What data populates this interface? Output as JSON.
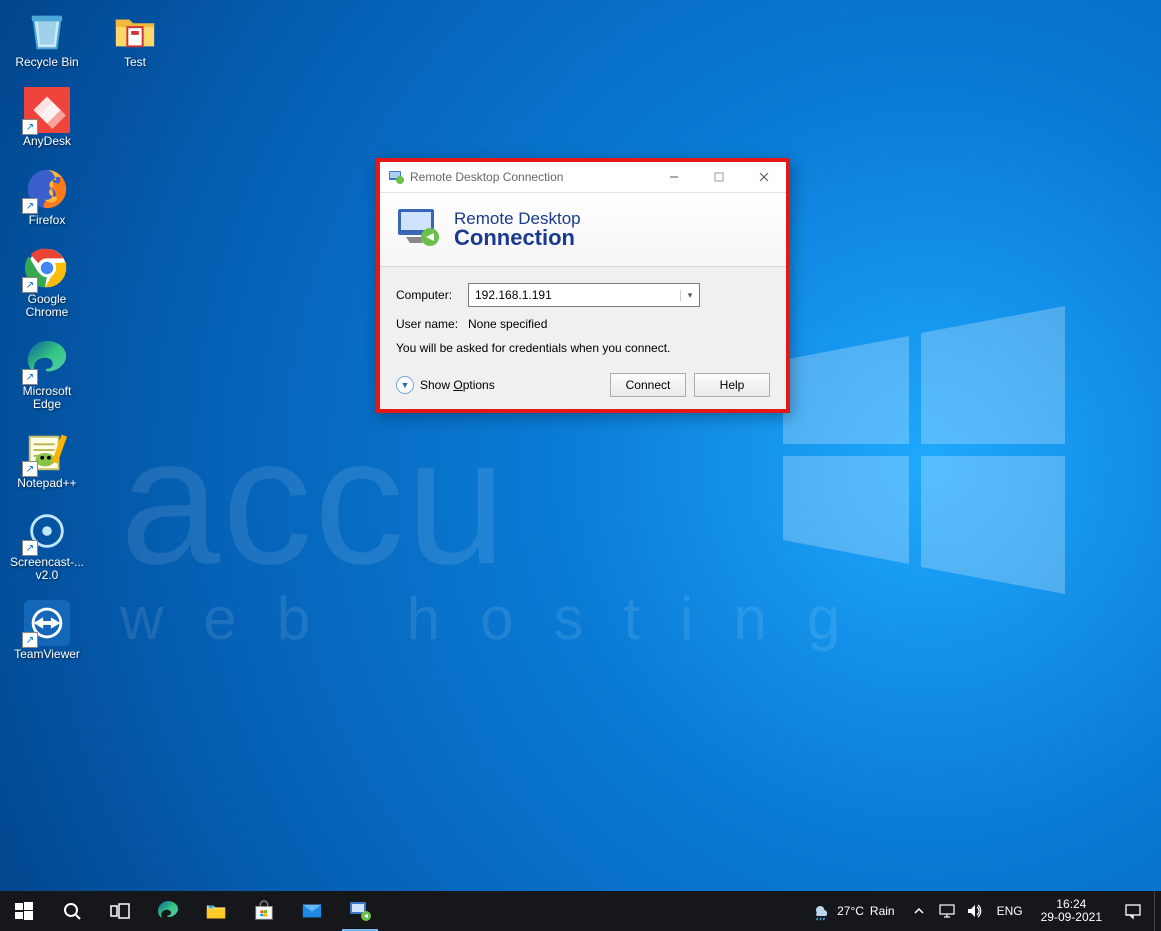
{
  "desktop_icons": [
    {
      "label": "Recycle Bin"
    },
    {
      "label": "AnyDesk"
    },
    {
      "label": "Firefox"
    },
    {
      "label": "Google Chrome"
    },
    {
      "label": "Microsoft Edge"
    },
    {
      "label": "Notepad++"
    },
    {
      "label": "Screencast-... v2.0"
    },
    {
      "label": "TeamViewer"
    }
  ],
  "test_folder_label": "Test",
  "rdc": {
    "title": "Remote Desktop Connection",
    "banner_line1": "Remote Desktop",
    "banner_line2": "Connection",
    "computer_label": "Computer:",
    "computer_value": "192.168.1.191",
    "username_label": "User name:",
    "username_value": "None specified",
    "note": "You will be asked for credentials when you connect.",
    "show_options": "Show Options",
    "show_options_rest": "ptions",
    "connect": "Connect",
    "help": "Help"
  },
  "taskbar": {
    "weather_temp": "27°C",
    "weather_cond": "Rain",
    "lang": "ENG",
    "time": "16:24",
    "date": "29-09-2021"
  },
  "watermark": {
    "big": "accu",
    "sub": "web hosting"
  }
}
